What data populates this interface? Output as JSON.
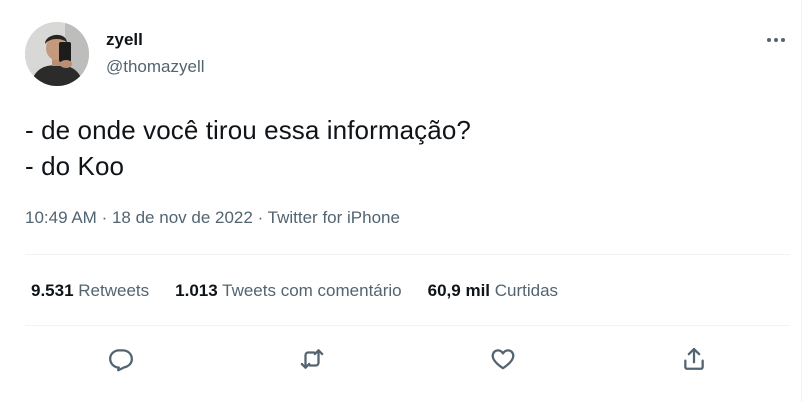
{
  "user": {
    "name": "zyell",
    "handle": "@thomazyell"
  },
  "tweet": {
    "text": "- de onde você tirou essa informação?\n- do Koo",
    "time": "10:49 AM",
    "date": "18 de nov de 2022",
    "source": "Twitter for iPhone",
    "separator": "·"
  },
  "stats": {
    "retweets_count": "9.531",
    "retweets_label": "Retweets",
    "quotes_count": "1.013",
    "quotes_label": "Tweets com comentário",
    "likes_count": "60,9 mil",
    "likes_label": "Curtidas"
  },
  "more_menu": {
    "icon": "more-horizontal-icon",
    "glyph": "···"
  },
  "actions": [
    {
      "name": "reply",
      "icon": "reply-icon"
    },
    {
      "name": "retweet",
      "icon": "retweet-icon"
    },
    {
      "name": "like",
      "icon": "heart-icon"
    },
    {
      "name": "share",
      "icon": "share-icon"
    }
  ],
  "colors": {
    "text_primary": "#0f1419",
    "text_secondary": "#536471",
    "divider": "#eff3f4",
    "background": "#ffffff"
  }
}
